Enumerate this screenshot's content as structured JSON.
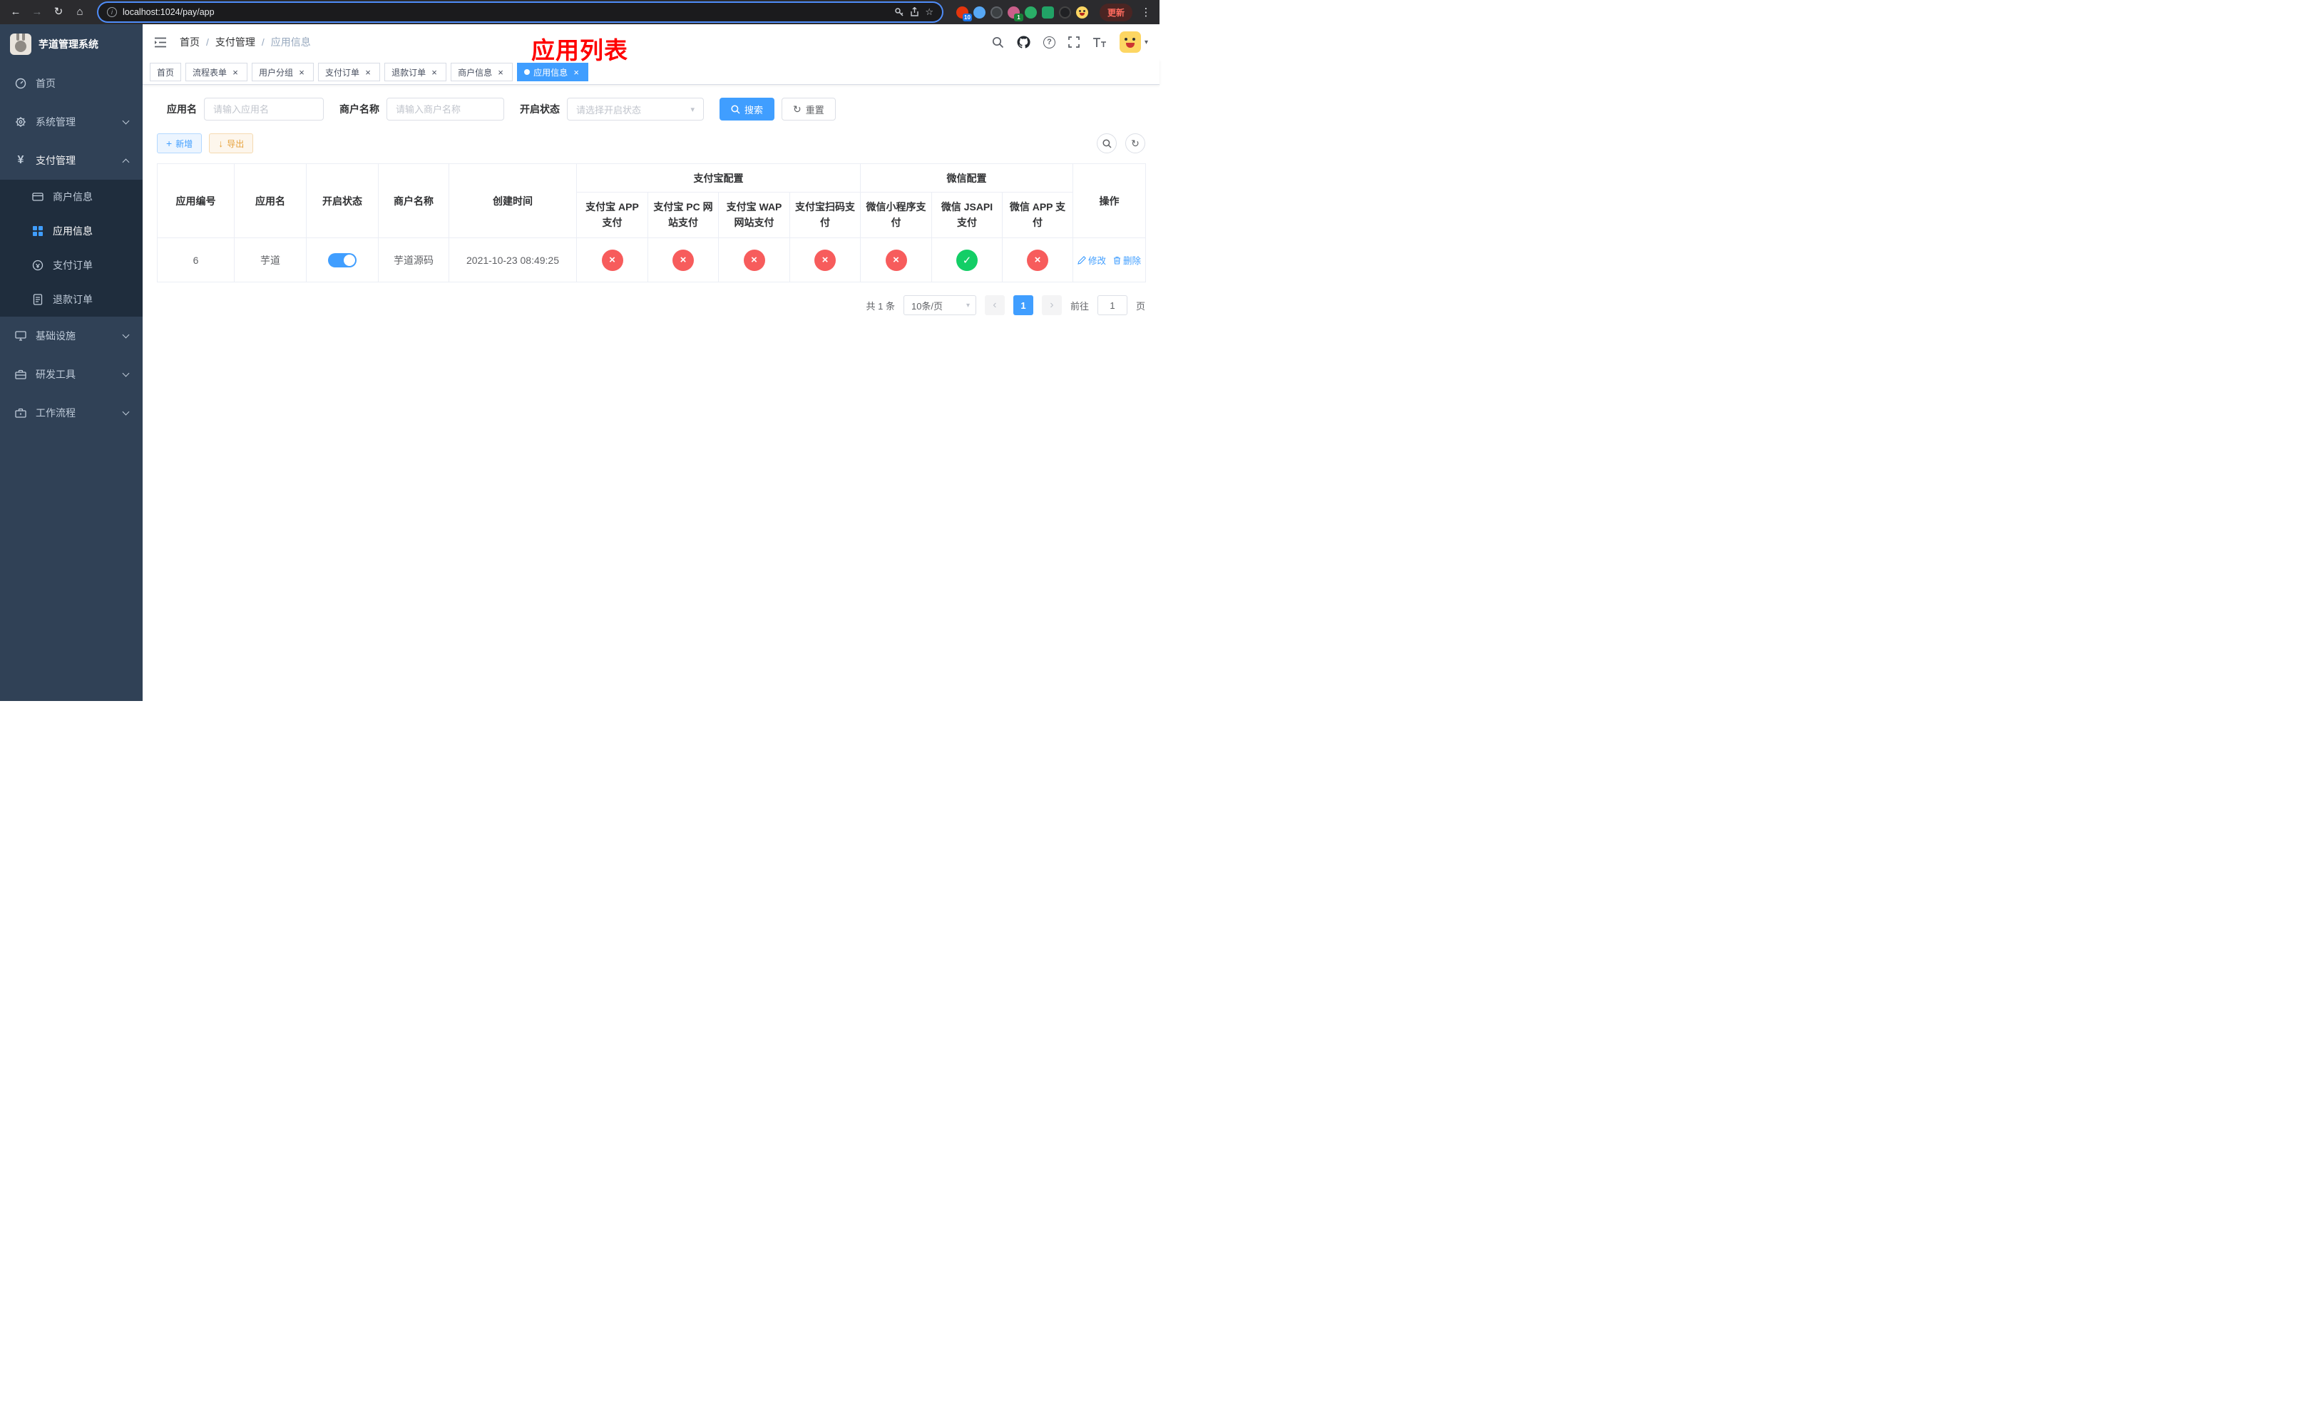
{
  "browser": {
    "url": "localhost:1024/pay/app",
    "update_label": "更新",
    "ext_badge_first": "10",
    "ext_badge_second": "1"
  },
  "icons": {
    "back": "←",
    "forward": "→",
    "reload": "↻",
    "home": "⌂",
    "info": "i",
    "star": "☆",
    "kebab": "⋮",
    "close": "×",
    "plus": "+",
    "download": "↓",
    "caret": "▾",
    "reset": "↻",
    "prev": "‹",
    "next": "›",
    "help": "?",
    "check": "✓",
    "cross": "×"
  },
  "sidebar": {
    "title": "芋道管理系统",
    "home": "首页",
    "system": "系统管理",
    "payment": "支付管理",
    "merchant_info": "商户信息",
    "app_info": "应用信息",
    "pay_order": "支付订单",
    "refund_order": "退款订单",
    "infra": "基础设施",
    "dev_tools": "研发工具",
    "workflow": "工作流程"
  },
  "breadcrumb": {
    "home": "首页",
    "level1": "支付管理",
    "current": "应用信息"
  },
  "annotation": "应用列表",
  "tabs": [
    {
      "label": "首页"
    },
    {
      "label": "流程表单"
    },
    {
      "label": "用户分组"
    },
    {
      "label": "支付订单"
    },
    {
      "label": "退款订单"
    },
    {
      "label": "商户信息"
    },
    {
      "label": "应用信息"
    }
  ],
  "filters": {
    "app_name_label": "应用名",
    "app_name_placeholder": "请输入应用名",
    "merchant_label": "商户名称",
    "merchant_placeholder": "请输入商户名称",
    "status_label": "开启状态",
    "status_placeholder": "请选择开启状态",
    "search_label": "搜索",
    "reset_label": "重置"
  },
  "toolbar": {
    "add_label": "新增",
    "export_label": "导出"
  },
  "table": {
    "head": {
      "app_id": "应用编号",
      "app_name": "应用名",
      "status": "开启状态",
      "merchant": "商户名称",
      "created": "创建时间",
      "group_alipay": "支付宝配置",
      "group_wechat": "微信配置",
      "alipay_app": "支付宝 APP 支付",
      "alipay_pc": "支付宝 PC 网站支付",
      "alipay_wap": "支付宝 WAP 网站支付",
      "alipay_qr": "支付宝扫码支付",
      "wx_mini": "微信小程序支付",
      "wx_jsapi": "微信 JSAPI 支付",
      "wx_app": "微信 APP 支付",
      "actions": "操作"
    },
    "row": {
      "id": "6",
      "name": "芋道",
      "enabled": true,
      "merchant": "芋道源码",
      "created": "2021-10-23 08:49:25",
      "statuses": [
        "no",
        "no",
        "no",
        "no",
        "no",
        "yes",
        "no"
      ],
      "edit_label": "修改",
      "delete_label": "删除"
    }
  },
  "pagination": {
    "total": "共 1 条",
    "size": "10条/页",
    "page": "1",
    "goto_label": "前往",
    "goto_value": "1",
    "page_unit": "页"
  },
  "colors": {
    "primary": "#409eff",
    "danger": "#f75c5c",
    "success": "#13ce66",
    "warning": "#e6a23c",
    "sidebar_bg": "#304156",
    "submenu_bg": "#1f2d3d",
    "annotation": "#ff0000"
  }
}
